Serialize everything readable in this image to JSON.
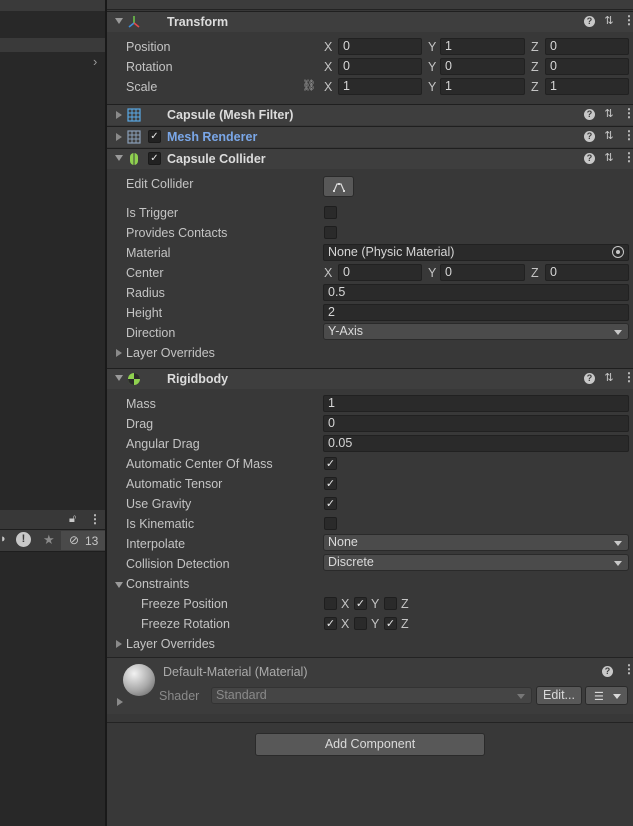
{
  "transform": {
    "title": "Transform",
    "position": {
      "label": "Position",
      "x": "0",
      "y": "1",
      "z": "0"
    },
    "rotation": {
      "label": "Rotation",
      "x": "0",
      "y": "0",
      "z": "0"
    },
    "scale": {
      "label": "Scale",
      "x": "1",
      "y": "1",
      "z": "1"
    }
  },
  "axes": {
    "x": "X",
    "y": "Y",
    "z": "Z"
  },
  "mesh_filter": {
    "title": "Capsule (Mesh Filter)"
  },
  "mesh_renderer": {
    "title": "Mesh Renderer"
  },
  "capsule_collider": {
    "title": "Capsule Collider",
    "edit_collider": "Edit Collider",
    "is_trigger": "Is Trigger",
    "provides_contacts": "Provides Contacts",
    "material": {
      "label": "Material",
      "value": "None (Physic Material)"
    },
    "center": {
      "label": "Center",
      "x": "0",
      "y": "0",
      "z": "0"
    },
    "radius": {
      "label": "Radius",
      "value": "0.5"
    },
    "height": {
      "label": "Height",
      "value": "2"
    },
    "direction": {
      "label": "Direction",
      "value": "Y-Axis"
    },
    "layer_overrides": "Layer Overrides"
  },
  "rigidbody": {
    "title": "Rigidbody",
    "mass": {
      "label": "Mass",
      "value": "1"
    },
    "drag": {
      "label": "Drag",
      "value": "0"
    },
    "angular_drag": {
      "label": "Angular Drag",
      "value": "0.05"
    },
    "auto_com": {
      "label": "Automatic Center Of Mass",
      "checked": true
    },
    "auto_tensor": {
      "label": "Automatic Tensor",
      "checked": true
    },
    "use_gravity": {
      "label": "Use Gravity",
      "checked": true
    },
    "is_kinematic": {
      "label": "Is Kinematic",
      "checked": false
    },
    "interpolate": {
      "label": "Interpolate",
      "value": "None"
    },
    "collision_detection": {
      "label": "Collision Detection",
      "value": "Discrete"
    },
    "constraints": "Constraints",
    "freeze_position": "Freeze Position",
    "freeze_rotation": "Freeze Rotation",
    "layer_overrides": "Layer Overrides"
  },
  "material": {
    "title": "Default-Material (Material)",
    "shader_label": "Shader",
    "shader_value": "Standard",
    "edit_button": "Edit..."
  },
  "add_component": "Add Component",
  "left_toolbar": {
    "hidden_count": "13"
  }
}
